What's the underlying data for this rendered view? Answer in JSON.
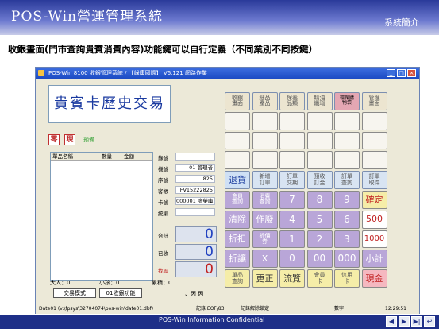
{
  "slide": {
    "title": "POS-Win營運管理系統",
    "tag": "系統簡介",
    "subtitle": "收銀畫面(門市查詢貴賓消費內容)功能鍵可以自行定義（不同業別不同按鍵）",
    "footer": "POS-Win Information Confidential"
  },
  "window": {
    "title": "POS-Win 8100 收銀管理系統 / 【綠康國際】 V6.121 網路作業",
    "min": "_",
    "max": "□",
    "close": "×"
  },
  "screen": {
    "big_title": "貴賓卡歷史交易",
    "tag1": "零",
    "tag2": "現",
    "tag3": "預備",
    "list_headers": [
      "單品名稱",
      "數量",
      "金額"
    ]
  },
  "info": [
    {
      "label": "錄號",
      "value": ""
    },
    {
      "label": "機號",
      "value": "01 管理者"
    },
    {
      "label": "序號",
      "value": "825"
    },
    {
      "label": "客帳",
      "value": "FV15222825"
    },
    {
      "label": "卡號",
      "value": "000001 廖榮庫"
    },
    {
      "label": "統編",
      "value": ""
    }
  ],
  "totals": [
    {
      "label": "合計",
      "value": "0"
    },
    {
      "label": "已收",
      "value": "0"
    },
    {
      "label": "找零",
      "value": "0"
    }
  ],
  "footer": {
    "qty_label": "大人：0",
    "sub_label": "小孩：0",
    "acc_label": "累積：0",
    "remain_label": "、丙 丙",
    "btn1": "交易模式",
    "btn2": "01收銀功能"
  },
  "status": {
    "path": "Date01 (v:\\fpsys\\32704074\\pos-win\\date01.dbf)",
    "rec": "記錄 EOF/83",
    "mode": "記錄解除鎖定",
    "num": "數字",
    "time": "12:29:51"
  },
  "keys": [
    {
      "r": 0,
      "c": 0,
      "label": "收銀畫面",
      "bg": "#ece5d0",
      "fg": "#555555",
      "fs": 7
    },
    {
      "r": 0,
      "c": 1,
      "label": "細品產品",
      "bg": "#ece5d0",
      "fg": "#555555",
      "fs": 7
    },
    {
      "r": 0,
      "c": 2,
      "label": "保養品類",
      "bg": "#ece5d0",
      "fg": "#555555",
      "fs": 7
    },
    {
      "r": 0,
      "c": 3,
      "label": "精油纖瑙",
      "bg": "#ece5d0",
      "fg": "#555555",
      "fs": 7
    },
    {
      "r": 0,
      "c": 4,
      "label": "環保購物袋",
      "bg": "#e4a7b3",
      "fg": "#000000",
      "fs": 6
    },
    {
      "r": 0,
      "c": 5,
      "label": "管理畫面",
      "bg": "#ece5d0",
      "fg": "#555555",
      "fs": 7
    },
    {
      "r": 1,
      "c": 0,
      "label": "",
      "bg": "#f7f5ef",
      "fg": "#000000",
      "fs": 7
    },
    {
      "r": 1,
      "c": 1,
      "label": "",
      "bg": "#f7f5ef",
      "fg": "#000000",
      "fs": 7
    },
    {
      "r": 1,
      "c": 2,
      "label": "",
      "bg": "#f7f5ef",
      "fg": "#000000",
      "fs": 7
    },
    {
      "r": 1,
      "c": 3,
      "label": "",
      "bg": "#f7f5ef",
      "fg": "#000000",
      "fs": 7
    },
    {
      "r": 1,
      "c": 4,
      "label": "",
      "bg": "#f7f5ef",
      "fg": "#000000",
      "fs": 7
    },
    {
      "r": 1,
      "c": 5,
      "label": "",
      "bg": "#f7f5ef",
      "fg": "#000000",
      "fs": 7
    },
    {
      "r": 2,
      "c": 0,
      "label": "",
      "bg": "#f7f5ef",
      "fg": "#000000",
      "fs": 7
    },
    {
      "r": 2,
      "c": 1,
      "label": "",
      "bg": "#f7f5ef",
      "fg": "#000000",
      "fs": 7
    },
    {
      "r": 2,
      "c": 2,
      "label": "",
      "bg": "#f7f5ef",
      "fg": "#000000",
      "fs": 7
    },
    {
      "r": 2,
      "c": 3,
      "label": "",
      "bg": "#f7f5ef",
      "fg": "#000000",
      "fs": 7
    },
    {
      "r": 2,
      "c": 4,
      "label": "",
      "bg": "#f7f5ef",
      "fg": "#000000",
      "fs": 7
    },
    {
      "r": 2,
      "c": 5,
      "label": "",
      "bg": "#f7f5ef",
      "fg": "#000000",
      "fs": 7
    },
    {
      "r": 3,
      "c": 0,
      "label": "",
      "bg": "#f7f5ef",
      "fg": "#000000",
      "fs": 7
    },
    {
      "r": 3,
      "c": 1,
      "label": "",
      "bg": "#f7f5ef",
      "fg": "#000000",
      "fs": 7
    },
    {
      "r": 3,
      "c": 2,
      "label": "",
      "bg": "#f7f5ef",
      "fg": "#000000",
      "fs": 7
    },
    {
      "r": 3,
      "c": 3,
      "label": "",
      "bg": "#f7f5ef",
      "fg": "#000000",
      "fs": 7
    },
    {
      "r": 3,
      "c": 4,
      "label": "",
      "bg": "#f7f5ef",
      "fg": "#000000",
      "fs": 7
    },
    {
      "r": 3,
      "c": 5,
      "label": "",
      "bg": "#f7f5ef",
      "fg": "#000000",
      "fs": 7
    },
    {
      "r": 4,
      "c": 0,
      "label": "退貨",
      "bg": "#cfe0f5",
      "fg": "#2040a0",
      "fs": 11
    },
    {
      "r": 4,
      "c": 1,
      "label": "新增訂單",
      "bg": "#d8e4f2",
      "fg": "#555555",
      "fs": 7
    },
    {
      "r": 4,
      "c": 2,
      "label": "訂單交期",
      "bg": "#d8e4f2",
      "fg": "#555555",
      "fs": 7
    },
    {
      "r": 4,
      "c": 3,
      "label": "預收訂金",
      "bg": "#d8e4f2",
      "fg": "#555555",
      "fs": 7
    },
    {
      "r": 4,
      "c": 4,
      "label": "訂單查詢",
      "bg": "#d8e4f2",
      "fg": "#555555",
      "fs": 7
    },
    {
      "r": 4,
      "c": 5,
      "label": "訂單取件",
      "bg": "#d8e4f2",
      "fg": "#555555",
      "fs": 7
    },
    {
      "r": 5,
      "c": 0,
      "label": "會員查詢",
      "bg": "#b9a6d8",
      "fg": "#ffffff",
      "fs": 7
    },
    {
      "r": 5,
      "c": 1,
      "label": "消費查詢",
      "bg": "#b9a6d8",
      "fg": "#ffffff",
      "fs": 7
    },
    {
      "r": 5,
      "c": 2,
      "label": "7",
      "bg": "#b9a6d8",
      "fg": "#ffffff",
      "fs": 12
    },
    {
      "r": 5,
      "c": 3,
      "label": "8",
      "bg": "#b9a6d8",
      "fg": "#ffffff",
      "fs": 12
    },
    {
      "r": 5,
      "c": 4,
      "label": "9",
      "bg": "#b9a6d8",
      "fg": "#ffffff",
      "fs": 12
    },
    {
      "r": 5,
      "c": 5,
      "label": "確定",
      "bg": "#f5eda8",
      "fg": "#c02020",
      "fs": 11
    },
    {
      "r": 6,
      "c": 0,
      "label": "清除",
      "bg": "#b9a6d8",
      "fg": "#ffffff",
      "fs": 11
    },
    {
      "r": 6,
      "c": 1,
      "label": "作廢",
      "bg": "#b9a6d8",
      "fg": "#ffffff",
      "fs": 11
    },
    {
      "r": 6,
      "c": 2,
      "label": "4",
      "bg": "#b9a6d8",
      "fg": "#ffffff",
      "fs": 12
    },
    {
      "r": 6,
      "c": 3,
      "label": "5",
      "bg": "#b9a6d8",
      "fg": "#ffffff",
      "fs": 12
    },
    {
      "r": 6,
      "c": 4,
      "label": "6",
      "bg": "#b9a6d8",
      "fg": "#ffffff",
      "fs": 12
    },
    {
      "r": 6,
      "c": 5,
      "label": "500",
      "bg": "#ffffff",
      "fg": "#c02020",
      "fs": 11
    },
    {
      "r": 7,
      "c": 0,
      "label": "折扣",
      "bg": "#b9a6d8",
      "fg": "#ffffff",
      "fs": 11
    },
    {
      "r": 7,
      "c": 1,
      "label": "折價券",
      "bg": "#b9a6d8",
      "fg": "#ffffff",
      "fs": 7
    },
    {
      "r": 7,
      "c": 2,
      "label": "1",
      "bg": "#b9a6d8",
      "fg": "#ffffff",
      "fs": 12
    },
    {
      "r": 7,
      "c": 3,
      "label": "2",
      "bg": "#b9a6d8",
      "fg": "#ffffff",
      "fs": 12
    },
    {
      "r": 7,
      "c": 4,
      "label": "3",
      "bg": "#b9a6d8",
      "fg": "#ffffff",
      "fs": 12
    },
    {
      "r": 7,
      "c": 5,
      "label": "1000",
      "bg": "#ffffff",
      "fg": "#c02020",
      "fs": 10
    },
    {
      "r": 8,
      "c": 0,
      "label": "折讓",
      "bg": "#b9a6d8",
      "fg": "#ffffff",
      "fs": 11
    },
    {
      "r": 8,
      "c": 1,
      "label": "X",
      "bg": "#b9a6d8",
      "fg": "#ffffff",
      "fs": 11
    },
    {
      "r": 8,
      "c": 2,
      "label": "0",
      "bg": "#b9a6d8",
      "fg": "#ffffff",
      "fs": 12
    },
    {
      "r": 8,
      "c": 3,
      "label": "00",
      "bg": "#b9a6d8",
      "fg": "#ffffff",
      "fs": 12
    },
    {
      "r": 8,
      "c": 4,
      "label": "000",
      "bg": "#b9a6d8",
      "fg": "#ffffff",
      "fs": 12
    },
    {
      "r": 8,
      "c": 5,
      "label": "小計",
      "bg": "#b9a6d8",
      "fg": "#ffffff",
      "fs": 11
    },
    {
      "r": 9,
      "c": 0,
      "label": "單品查詢",
      "bg": "#f5eda8",
      "fg": "#555555",
      "fs": 7
    },
    {
      "r": 9,
      "c": 1,
      "label": "更正",
      "bg": "#f5eda8",
      "fg": "#333333",
      "fs": 11
    },
    {
      "r": 9,
      "c": 2,
      "label": "流覽",
      "bg": "#f5eda8",
      "fg": "#333333",
      "fs": 11
    },
    {
      "r": 9,
      "c": 3,
      "label": "會員卡",
      "bg": "#f5eda8",
      "fg": "#555555",
      "fs": 7
    },
    {
      "r": 9,
      "c": 4,
      "label": "信用卡",
      "bg": "#f5eda8",
      "fg": "#555555",
      "fs": 7
    },
    {
      "r": 9,
      "c": 5,
      "label": "現金",
      "bg": "#f5b8c0",
      "fg": "#c02020",
      "fs": 11
    }
  ],
  "nav": [
    "◀",
    "▶",
    "▶|",
    "↩"
  ]
}
